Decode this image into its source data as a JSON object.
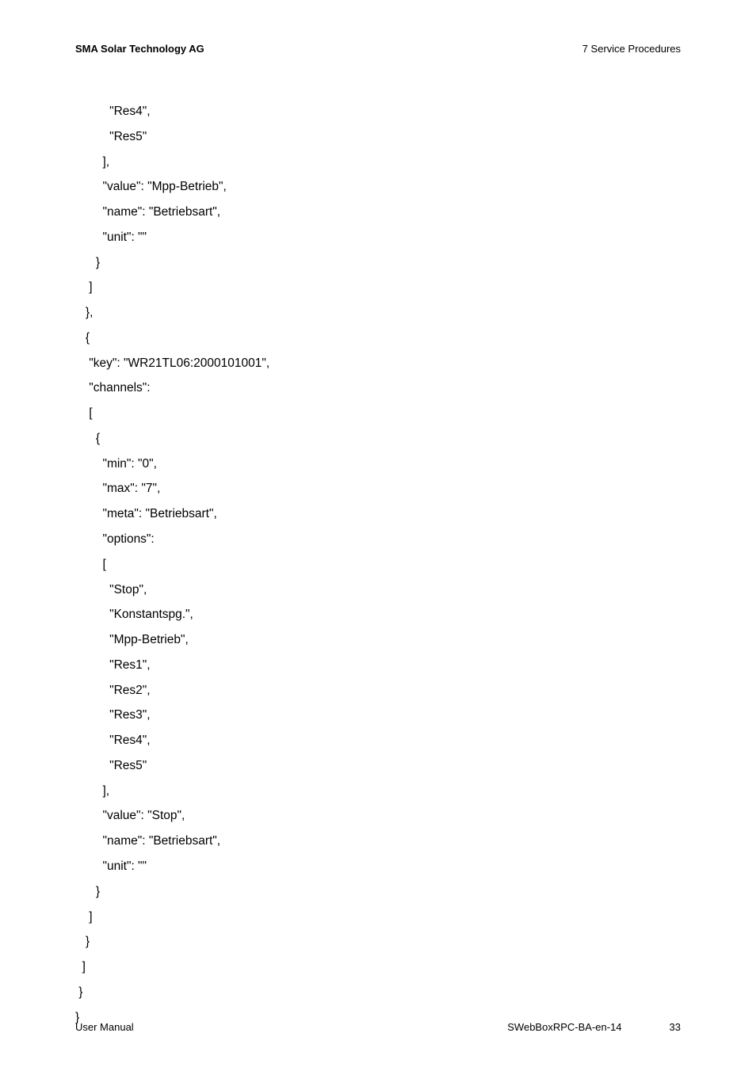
{
  "header": {
    "left": "SMA Solar Technology AG",
    "right": "7  Service Procedures"
  },
  "code": {
    "lines": [
      "          \"Res4\",",
      "          \"Res5\"",
      "        ],",
      "        \"value\": \"Mpp-Betrieb\",",
      "        \"name\": \"Betriebsart\",",
      "        \"unit\": \"\"",
      "      }",
      "    ]",
      "   },",
      "   {",
      "    \"key\": \"WR21TL06:2000101001\",",
      "    \"channels\":",
      "    [",
      "      {",
      "        \"min\": \"0\",",
      "        \"max\": \"7\",",
      "        \"meta\": \"Betriebsart\",",
      "        \"options\":",
      "        [",
      "          \"Stop\",",
      "          \"Konstantspg.\",",
      "          \"Mpp-Betrieb\",",
      "          \"Res1\",",
      "          \"Res2\",",
      "          \"Res3\",",
      "          \"Res4\",",
      "          \"Res5\"",
      "        ],",
      "        \"value\": \"Stop\",",
      "        \"name\": \"Betriebsart\",",
      "        \"unit\": \"\"",
      "      }",
      "    ]",
      "   }",
      "  ]",
      " }",
      "}"
    ]
  },
  "footer": {
    "left": "User Manual",
    "docid": "SWebBoxRPC-BA-en-14",
    "page": "33"
  }
}
